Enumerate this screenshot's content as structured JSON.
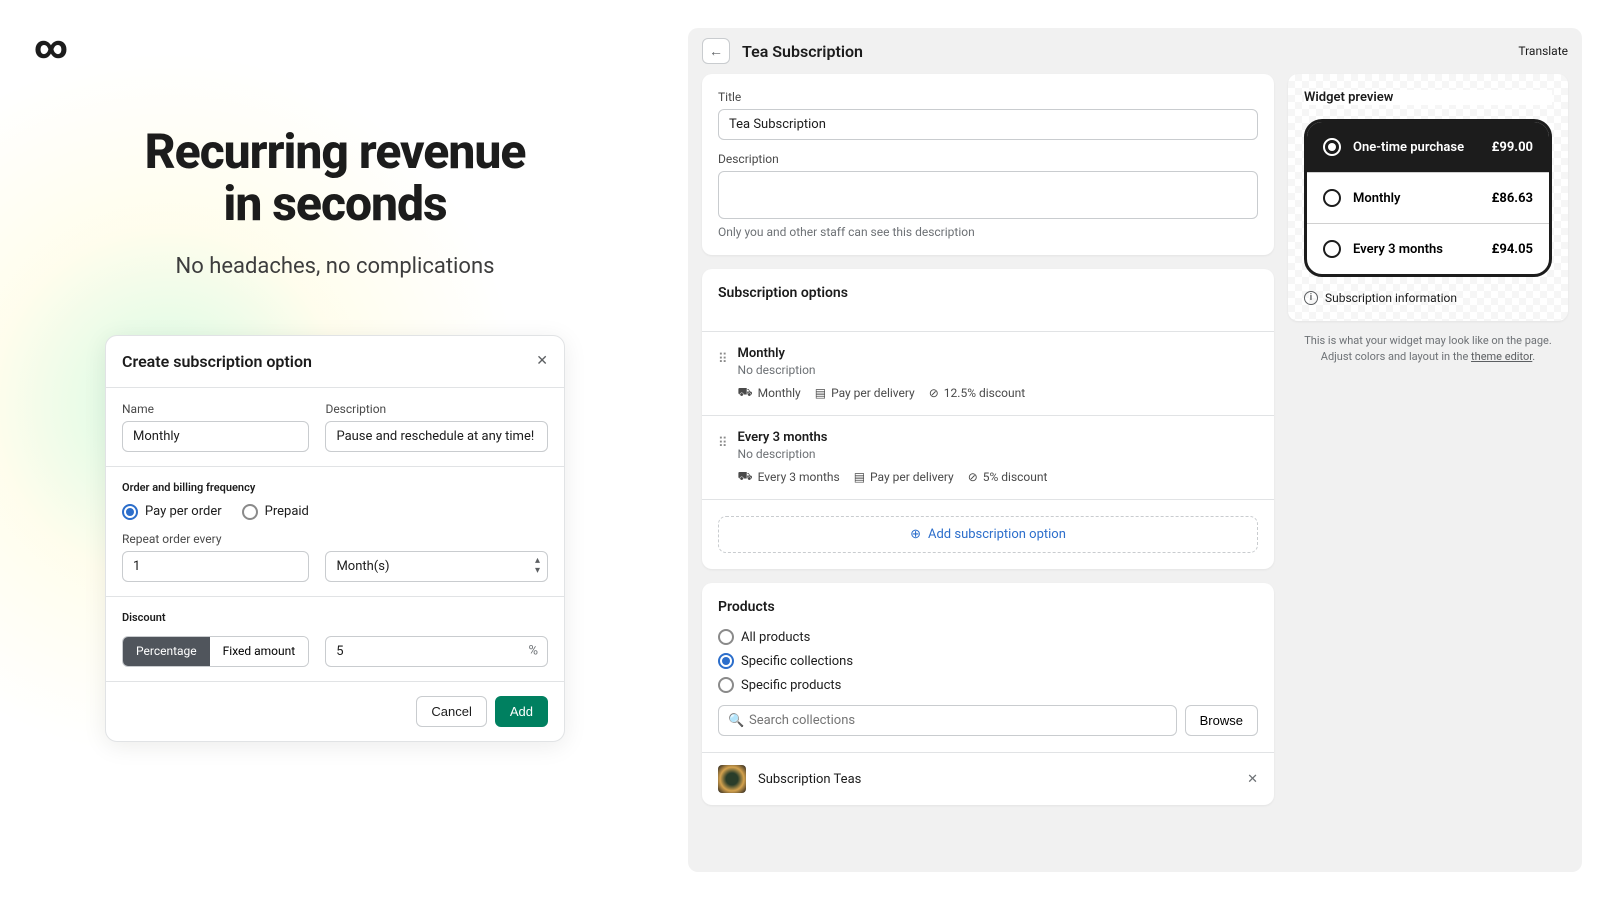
{
  "hero": {
    "title_l1": "Recurring revenue",
    "title_l2": "in seconds",
    "subtitle": "No headaches, no complications"
  },
  "modal": {
    "title": "Create subscription option",
    "name_label": "Name",
    "name_value": "Monthly",
    "desc_label": "Description",
    "desc_value": "Pause and reschedule at any time!",
    "freq_section": "Order and billing frequency",
    "pay_per_order": "Pay per order",
    "prepaid": "Prepaid",
    "repeat_label": "Repeat order every",
    "repeat_value": "1",
    "unit_value": "Month(s)",
    "discount_section": "Discount",
    "seg_pct": "Percentage",
    "seg_fixed": "Fixed amount",
    "discount_value": "5",
    "pct_suffix": "%",
    "cancel": "Cancel",
    "add": "Add"
  },
  "admin": {
    "page_title": "Tea Subscription",
    "translate": "Translate",
    "title_label": "Title",
    "title_value": "Tea Subscription",
    "desc_label": "Description",
    "desc_help": "Only you and other staff can see this description",
    "options_heading": "Subscription options",
    "options": [
      {
        "name": "Monthly",
        "sub": "No description",
        "freq": "Monthly",
        "billing": "Pay per delivery",
        "discount": "12.5% discount"
      },
      {
        "name": "Every 3 months",
        "sub": "No description",
        "freq": "Every 3 months",
        "billing": "Pay per delivery",
        "discount": "5% discount"
      }
    ],
    "add_option": "Add subscription option",
    "products_heading": "Products",
    "prod_all": "All products",
    "prod_collections": "Specific collections",
    "prod_specific": "Specific products",
    "search_placeholder": "Search collections",
    "browse": "Browse",
    "collection": "Subscription Teas"
  },
  "widget": {
    "heading": "Widget preview",
    "opts": [
      {
        "label": "One-time purchase",
        "price": "£99.00"
      },
      {
        "label": "Monthly",
        "price": "£86.63"
      },
      {
        "label": "Every 3 months",
        "price": "£94.05"
      }
    ],
    "sub_info": "Subscription information",
    "caption_pre": "This is what your widget may look like on the page. Adjust colors and layout in the ",
    "caption_link": "theme editor"
  }
}
